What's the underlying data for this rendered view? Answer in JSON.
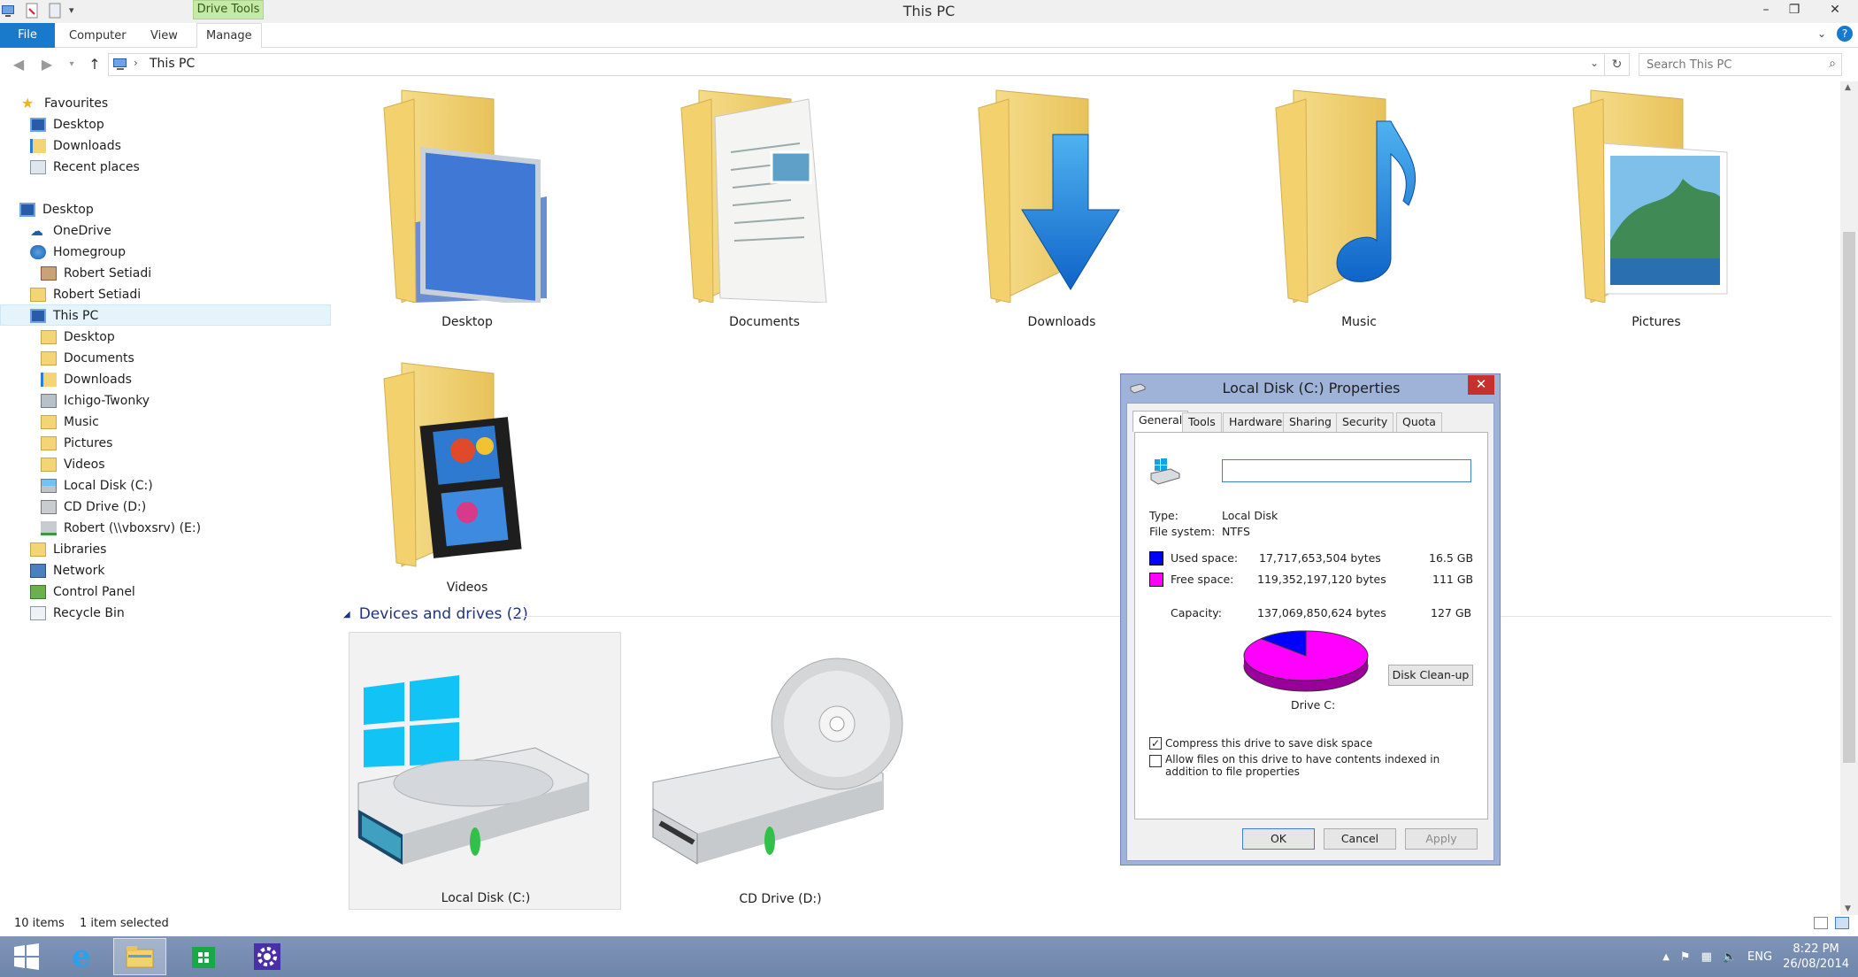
{
  "window": {
    "title": "This PC",
    "context_tab": "Drive Tools",
    "controls": [
      "–",
      "❐",
      "✕"
    ]
  },
  "ribbon": {
    "tabs": [
      "File",
      "Computer",
      "View",
      "Manage"
    ]
  },
  "address": {
    "path": "This PC",
    "search_placeholder": "Search This PC"
  },
  "nav": {
    "favourites": "Favourites",
    "fav_items": [
      "Desktop",
      "Downloads",
      "Recent places"
    ],
    "desktop": "Desktop",
    "items": [
      "OneDrive",
      "Homegroup",
      "Robert Setiadi",
      "Robert Setiadi",
      "This PC",
      "Desktop",
      "Documents",
      "Downloads",
      "Ichigo-Twonky",
      "Music",
      "Pictures",
      "Videos",
      "Local Disk (C:)",
      "CD Drive (D:)",
      "Robert (\\\\vboxsrv) (E:)",
      "Libraries",
      "Network",
      "Control Panel",
      "Recycle Bin"
    ]
  },
  "folders": [
    "Desktop",
    "Documents",
    "Downloads",
    "Music",
    "Pictures",
    "Videos"
  ],
  "devices": {
    "header": "Devices and drives (2)",
    "drives": [
      "Local Disk (C:)",
      "CD Drive (D:)"
    ]
  },
  "status": {
    "count": "10 items",
    "selected": "1 item selected"
  },
  "taskbar": {
    "lang": "ENG",
    "time": "8:22 PM",
    "date": "26/08/2014"
  },
  "dialog": {
    "title": "Local Disk (C:) Properties",
    "tabs": [
      "General",
      "Tools",
      "Hardware",
      "Sharing",
      "Security",
      "Quota"
    ],
    "type_label": "Type:",
    "type_value": "Local Disk",
    "fs_label": "File system:",
    "fs_value": "NTFS",
    "used_label": "Used space:",
    "used_bytes": "17,717,653,504 bytes",
    "used_gb": "16.5 GB",
    "free_label": "Free space:",
    "free_bytes": "119,352,197,120 bytes",
    "free_gb": "111 GB",
    "cap_label": "Capacity:",
    "cap_bytes": "137,069,850,624 bytes",
    "cap_gb": "127 GB",
    "drive_label": "Drive C:",
    "cleanup": "Disk Clean-up",
    "compress": "Compress this drive to save disk space",
    "compress_checked": true,
    "index": "Allow files on this drive to have contents indexed in addition to file properties",
    "index_checked": false,
    "ok": "OK",
    "cancel": "Cancel",
    "apply": "Apply",
    "used_color": "#0000ff",
    "free_color": "#ff00ff",
    "used_fraction": 0.129
  }
}
